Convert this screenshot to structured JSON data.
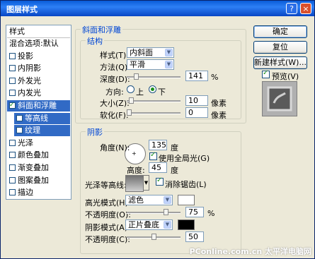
{
  "window": {
    "title": "图层样式",
    "help_icon": "?",
    "close_icon": "×"
  },
  "styles_panel": {
    "header": "样式",
    "items": [
      {
        "label": "混合选项:默认",
        "check": false
      },
      {
        "label": "投影",
        "check": true,
        "checked": false
      },
      {
        "label": "内阴影",
        "check": true,
        "checked": false
      },
      {
        "label": "外发光",
        "check": true,
        "checked": false
      },
      {
        "label": "内发光",
        "check": true,
        "checked": false
      },
      {
        "label": "斜面和浮雕",
        "check": true,
        "checked": true,
        "selected": true
      },
      {
        "label": "等高线",
        "check": true,
        "checked": false,
        "sub": true
      },
      {
        "label": "纹理",
        "check": true,
        "checked": false,
        "sub": true
      },
      {
        "label": "光泽",
        "check": true,
        "checked": false
      },
      {
        "label": "颜色叠加",
        "check": true,
        "checked": false
      },
      {
        "label": "渐变叠加",
        "check": true,
        "checked": false
      },
      {
        "label": "图案叠加",
        "check": true,
        "checked": false
      },
      {
        "label": "描边",
        "check": true,
        "checked": false
      }
    ]
  },
  "bevel": {
    "group_title": "斜面和浮雕",
    "structure_title": "结构",
    "style_label": "样式(T):",
    "style_value": "内斜面",
    "technique_label": "方法(Q):",
    "technique_value": "平滑",
    "depth_label": "深度(D):",
    "depth_value": "141",
    "depth_unit": "%",
    "depth_fraction": 0.14,
    "direction_label": "方向:",
    "dir_up": "上",
    "dir_down": "下",
    "direction": "down",
    "size_label": "大小(Z):",
    "size_value": "10",
    "size_unit": "像素",
    "size_fraction": 0.04,
    "soften_label": "软化(F):",
    "soften_value": "0",
    "soften_unit": "像素",
    "soften_fraction": 0.0
  },
  "shading": {
    "title": "阴影",
    "angle_label": "角度(N):",
    "angle_value": "135",
    "angle_unit": "度",
    "global_light_label": "使用全局光(G)",
    "global_light": true,
    "altitude_label": "高度:",
    "altitude_value": "45",
    "altitude_unit": "度",
    "gloss_label": "光泽等高线:",
    "anti_alias_label": "消除锯齿(L)",
    "anti_alias": true,
    "highlight_mode_label": "高光模式(H):",
    "highlight_mode_value": "滤色",
    "highlight_color": "#ffffff",
    "highlight_opacity_label": "不透明度(O):",
    "highlight_opacity_value": "75",
    "highlight_opacity_unit": "%",
    "highlight_opacity_fraction": 0.75,
    "shadow_mode_label": "阴影模式(A):",
    "shadow_mode_value": "正片叠底",
    "shadow_color": "#000000",
    "shadow_opacity_label": "不透明度(C):",
    "shadow_opacity_value": "50",
    "shadow_opacity_fraction": 0.5
  },
  "buttons": {
    "ok": "确定",
    "reset": "复位",
    "new_style": "新建样式(W)...",
    "preview_label": "预览(V)",
    "preview_checked": true
  },
  "watermark": "PConline.com.cn 太平洋电脑网"
}
